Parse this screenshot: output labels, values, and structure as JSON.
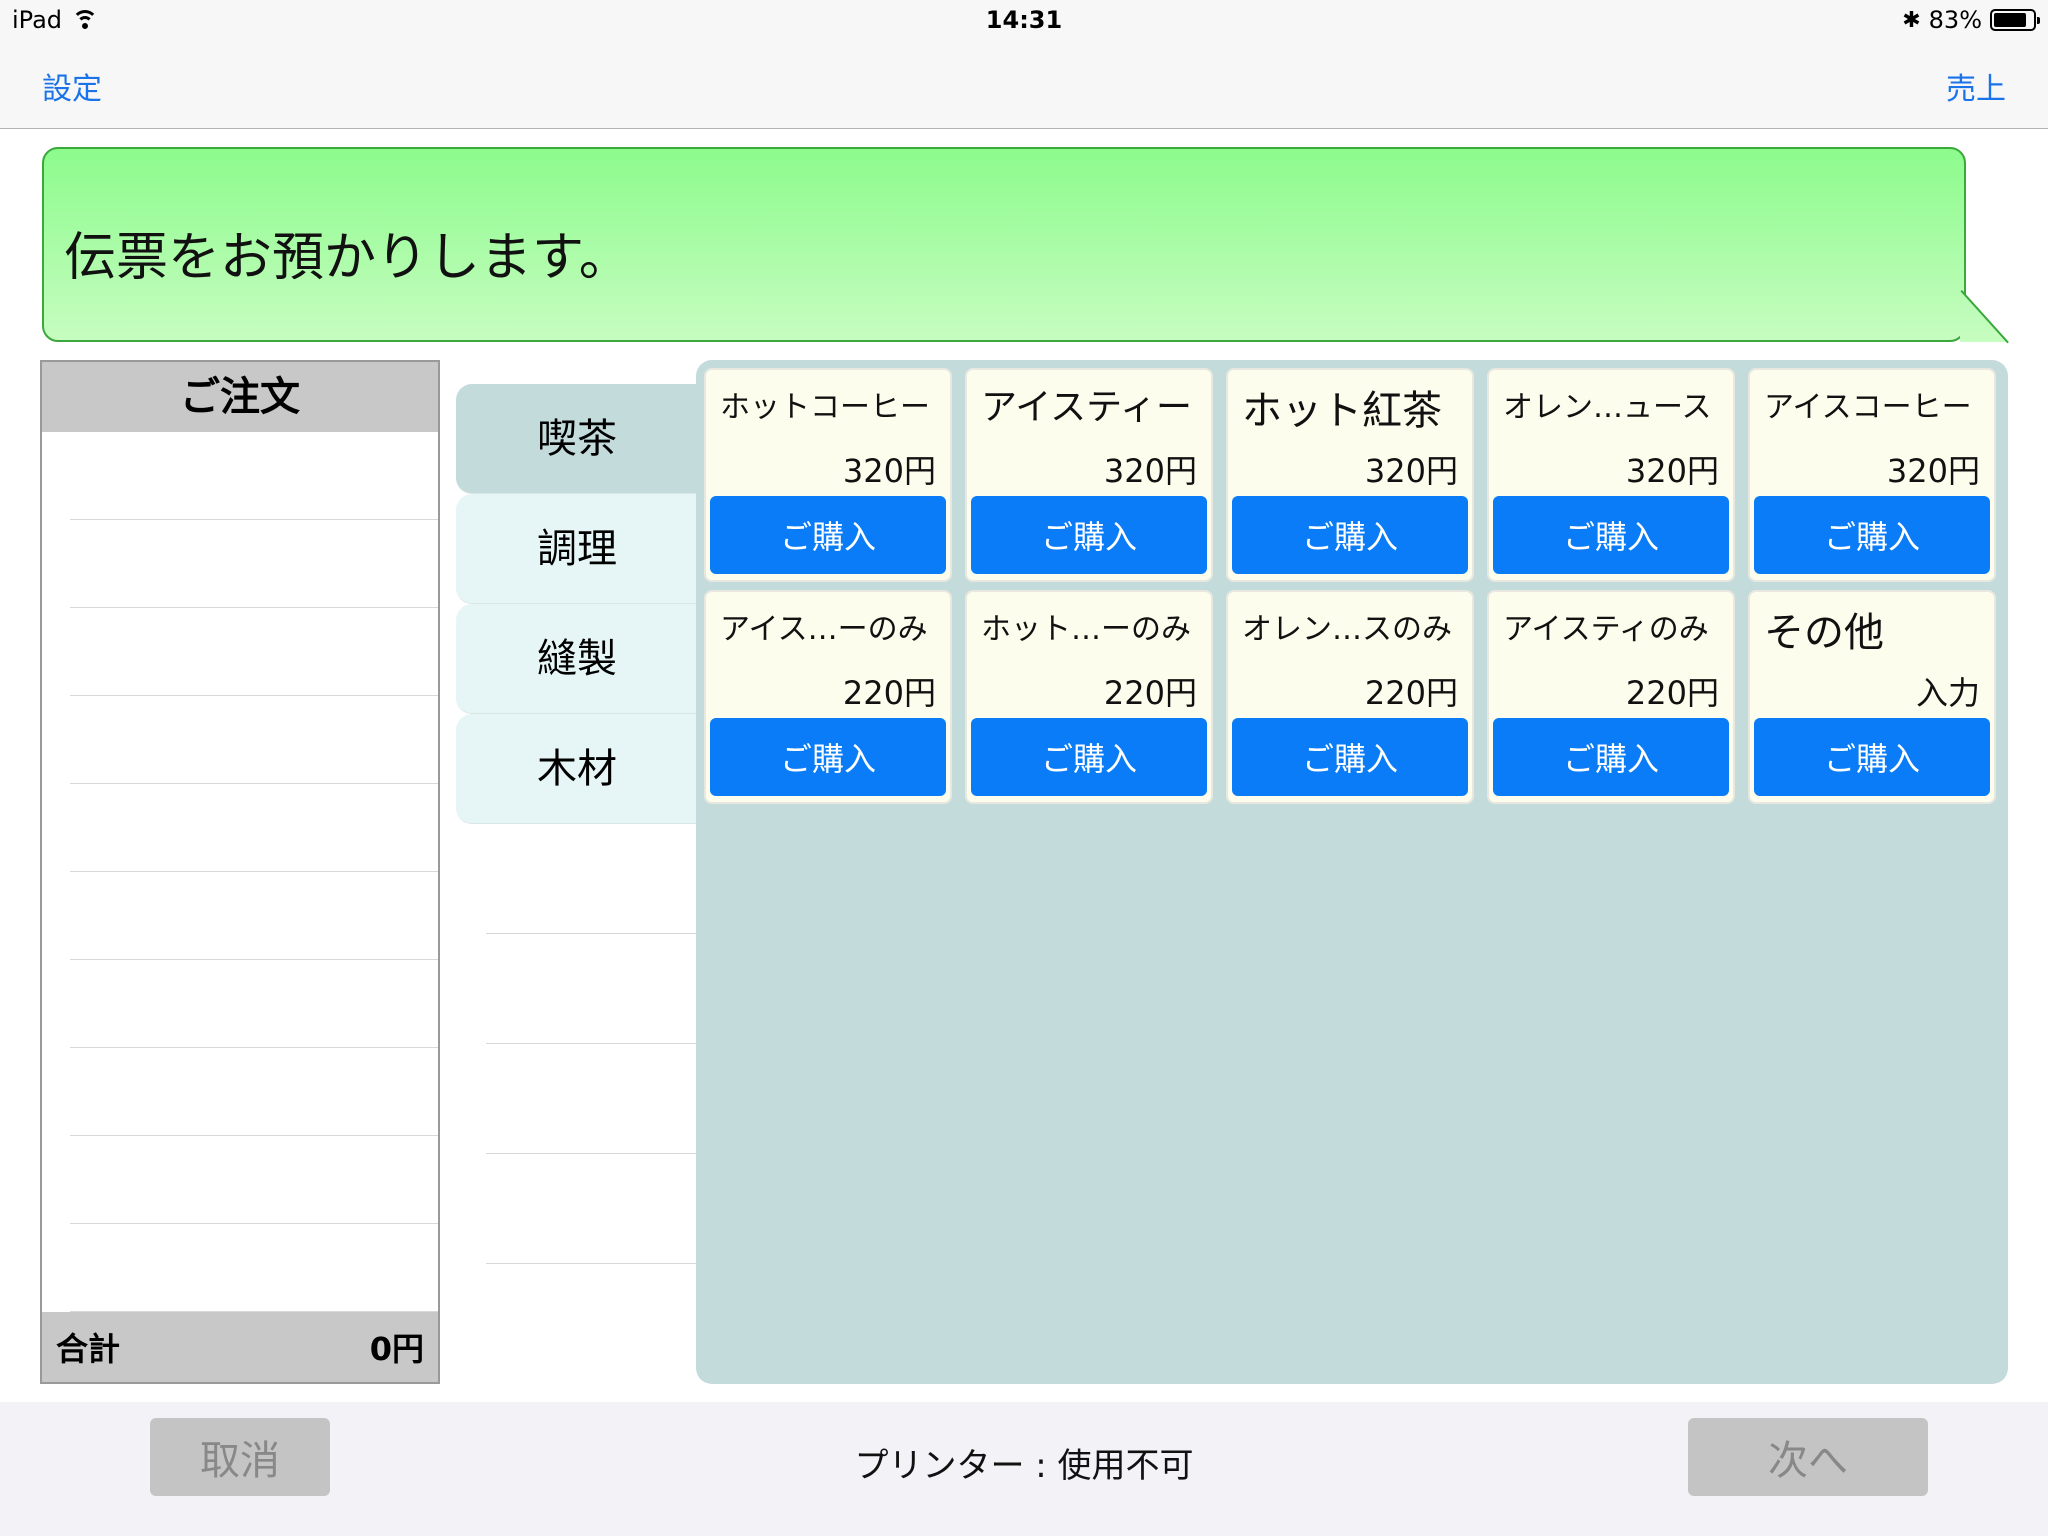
{
  "status_bar": {
    "device": "iPad",
    "time": "14:31",
    "battery": "83%",
    "battery_level": 0.83
  },
  "nav": {
    "left": "設定",
    "right": "売上"
  },
  "message": "伝票をお預かりします。",
  "order": {
    "title": "ご注文",
    "total_label": "合計",
    "total_value": "0円"
  },
  "categories": [
    {
      "label": "喫茶"
    },
    {
      "label": "調理"
    },
    {
      "label": "縫製"
    },
    {
      "label": "木材"
    }
  ],
  "products": [
    {
      "name": "ホットコーヒー",
      "price": "320円",
      "button": "ご購入"
    },
    {
      "name": "アイスティー",
      "price": "320円",
      "button": "ご購入"
    },
    {
      "name": "ホット紅茶",
      "price": "320円",
      "button": "ご購入"
    },
    {
      "name": "オレン…ュース",
      "price": "320円",
      "button": "ご購入"
    },
    {
      "name": "アイスコーヒー",
      "price": "320円",
      "button": "ご購入"
    },
    {
      "name": "アイス…ーのみ",
      "price": "220円",
      "button": "ご購入"
    },
    {
      "name": "ホット…ーのみ",
      "price": "220円",
      "button": "ご購入"
    },
    {
      "name": "オレン…スのみ",
      "price": "220円",
      "button": "ご購入"
    },
    {
      "name": "アイスティのみ",
      "price": "220円",
      "button": "ご購入"
    },
    {
      "name": "その他",
      "price": "入力",
      "button": "ご購入"
    }
  ],
  "bottom": {
    "cancel": "取消",
    "printer": "プリンター : 使用不可",
    "next": "次へ"
  },
  "colors": {
    "accent": "#0a7cf7",
    "bubble": "#8cfb8c",
    "grid_bg": "#c4dbdc",
    "card_bg": "#fdfdee"
  }
}
